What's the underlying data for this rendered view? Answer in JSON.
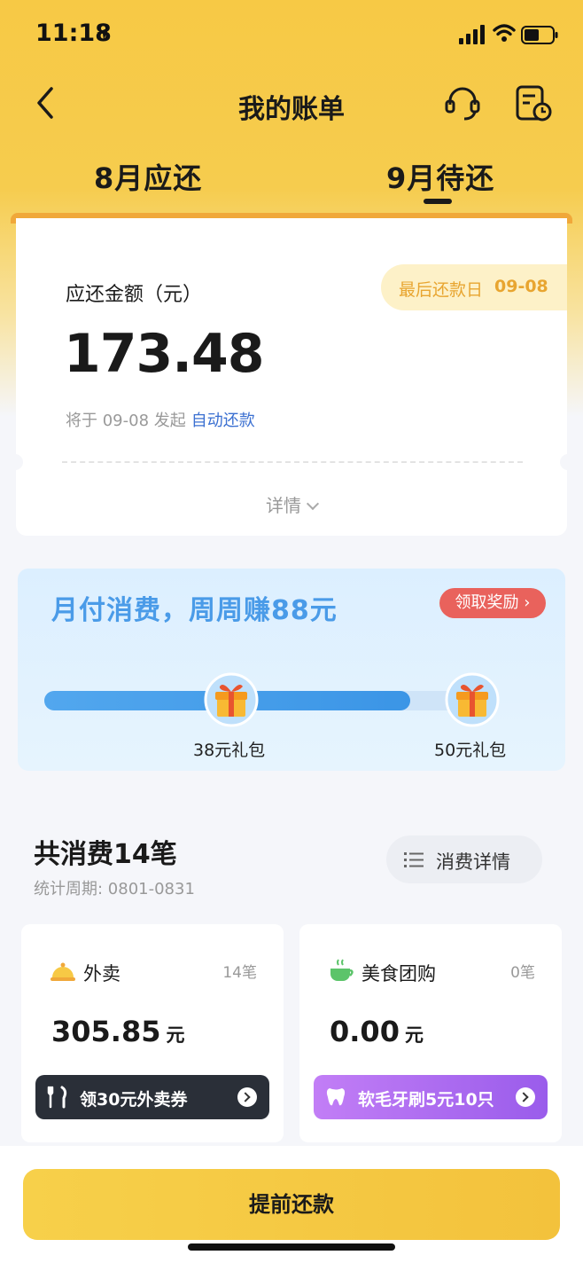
{
  "status_bar": {
    "time": "11:18"
  },
  "nav": {
    "title": "我的账单"
  },
  "tabs": [
    {
      "label": "8月应还"
    },
    {
      "label": "9月待还"
    }
  ],
  "active_tab": "9月待还",
  "bill": {
    "amount_label": "应还金额（元）",
    "amount": "173.48",
    "due_pill_label": "最后还款日",
    "due_date": "09-08",
    "auto_text": "将于 09-08 发起",
    "auto_link": "自动还款",
    "detail_label": "详情"
  },
  "promo": {
    "title": "月付消费，周周赚88元",
    "reward_button": "领取奖励 ›",
    "progress_fraction": 0.81,
    "gift_1_label": "38元礼包",
    "gift_2_label": "50元礼包"
  },
  "summary": {
    "title": "共消费14笔",
    "period": "统计周期: 0801-0831",
    "detail_button": "消费详情"
  },
  "categories": [
    {
      "name": "外卖",
      "count": "14笔",
      "amount": "305.85",
      "unit": "元",
      "cta": "领30元外卖券",
      "icon": "food-cloche-icon"
    },
    {
      "name": "美食团购",
      "count": "0笔",
      "amount": "0.00",
      "unit": "元",
      "cta": "软毛牙刷5元10只",
      "icon": "coffee-cup-icon"
    }
  ],
  "footer": {
    "pay_button": "提前还款"
  },
  "colors": {
    "brand_yellow": "#f7c945",
    "link_blue": "#3a6fd1",
    "promo_blue": "#4a9be8",
    "reward_red": "#e9625c"
  }
}
